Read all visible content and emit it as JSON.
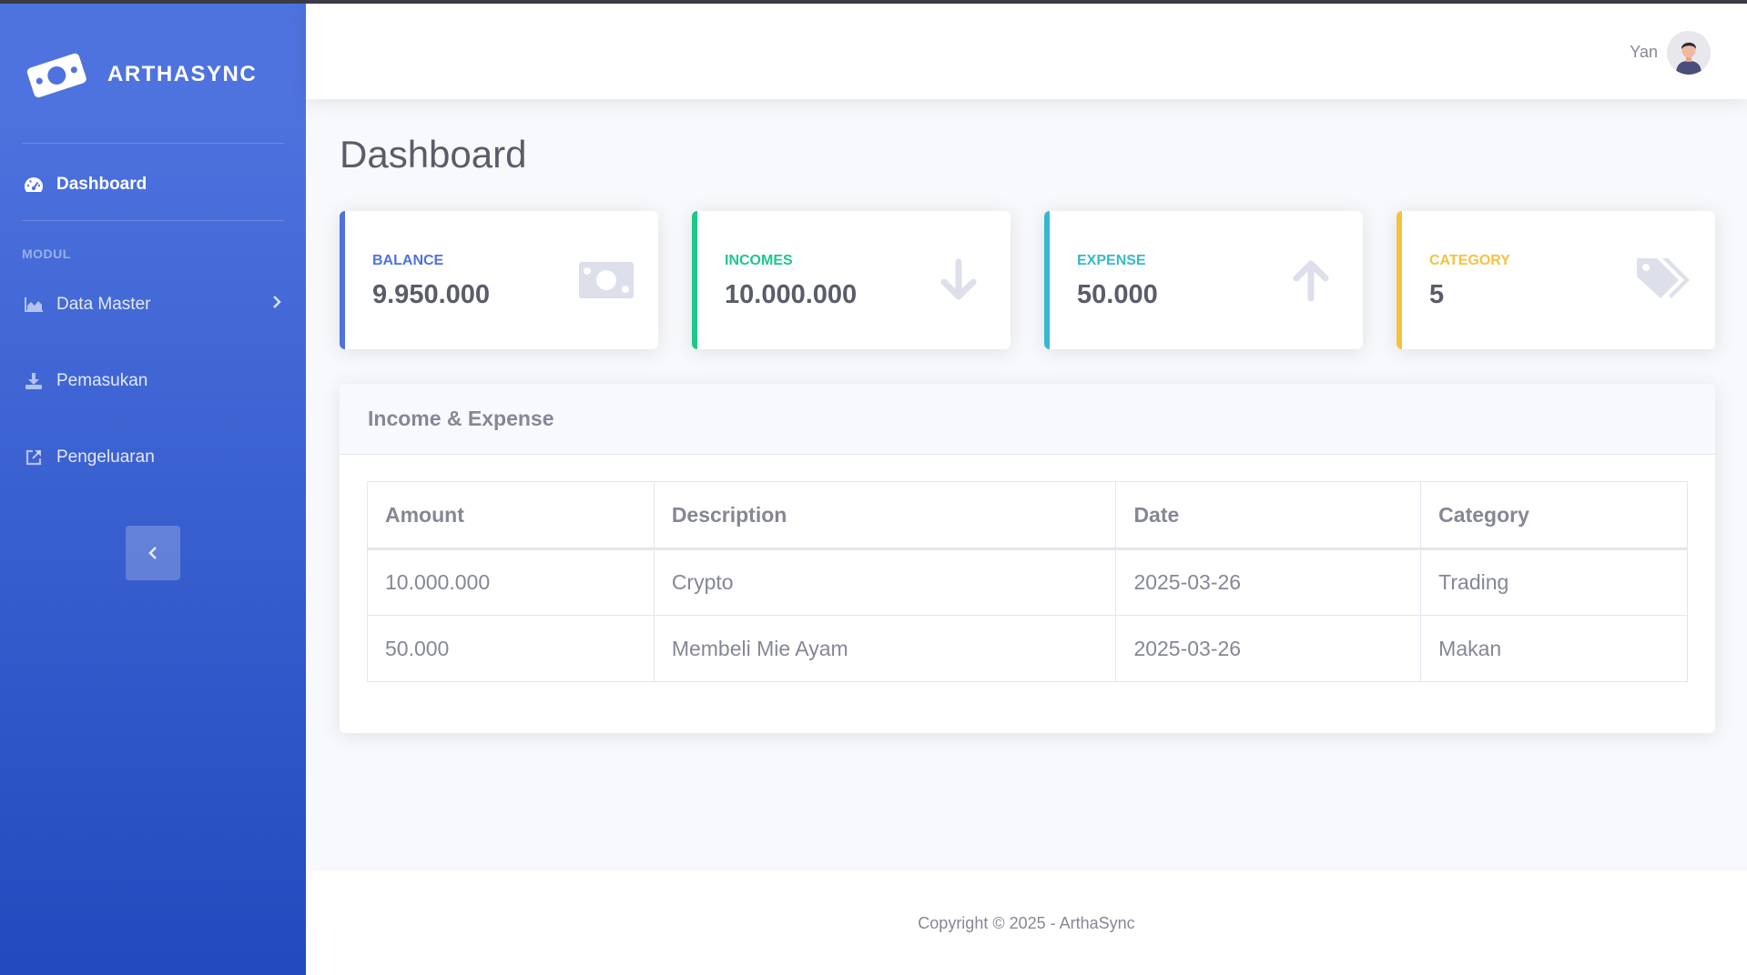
{
  "brand": {
    "name": "ARTHASYNC",
    "icon": "money-bill-icon"
  },
  "sidebar": {
    "dashboard": {
      "label": "Dashboard",
      "icon": "tachometer-icon"
    },
    "heading": "MODUL",
    "items": [
      {
        "label": "Data Master",
        "icon": "chart-area-icon"
      },
      {
        "label": "Pemasukan",
        "icon": "download-icon"
      },
      {
        "label": "Pengeluaran",
        "icon": "external-link-icon"
      }
    ],
    "toggle_icon": "chevron-left-icon"
  },
  "topbar": {
    "user_name": "Yan"
  },
  "page": {
    "title": "Dashboard"
  },
  "cards": [
    {
      "label": "BALANCE",
      "value": "9.950.000",
      "color": "#4e73df",
      "icon": "money-bill-icon"
    },
    {
      "label": "INCOMES",
      "value": "10.000.000",
      "color": "#1cc88a",
      "icon": "arrow-down-icon"
    },
    {
      "label": "EXPENSE",
      "value": "50.000",
      "color": "#36b9cc",
      "icon": "arrow-up-icon"
    },
    {
      "label": "CATEGORY",
      "value": "5",
      "color": "#f6c23e",
      "icon": "tags-icon"
    }
  ],
  "panel": {
    "title": "Income & Expense",
    "columns": [
      "Amount",
      "Description",
      "Date",
      "Category"
    ],
    "rows": [
      [
        "10.000.000",
        "Crypto",
        "2025-03-26",
        "Trading"
      ],
      [
        "50.000",
        "Membeli Mie Ayam",
        "2025-03-26",
        "Makan"
      ]
    ]
  },
  "footer": {
    "text": "Copyright © 2025 - ArthaSync"
  }
}
